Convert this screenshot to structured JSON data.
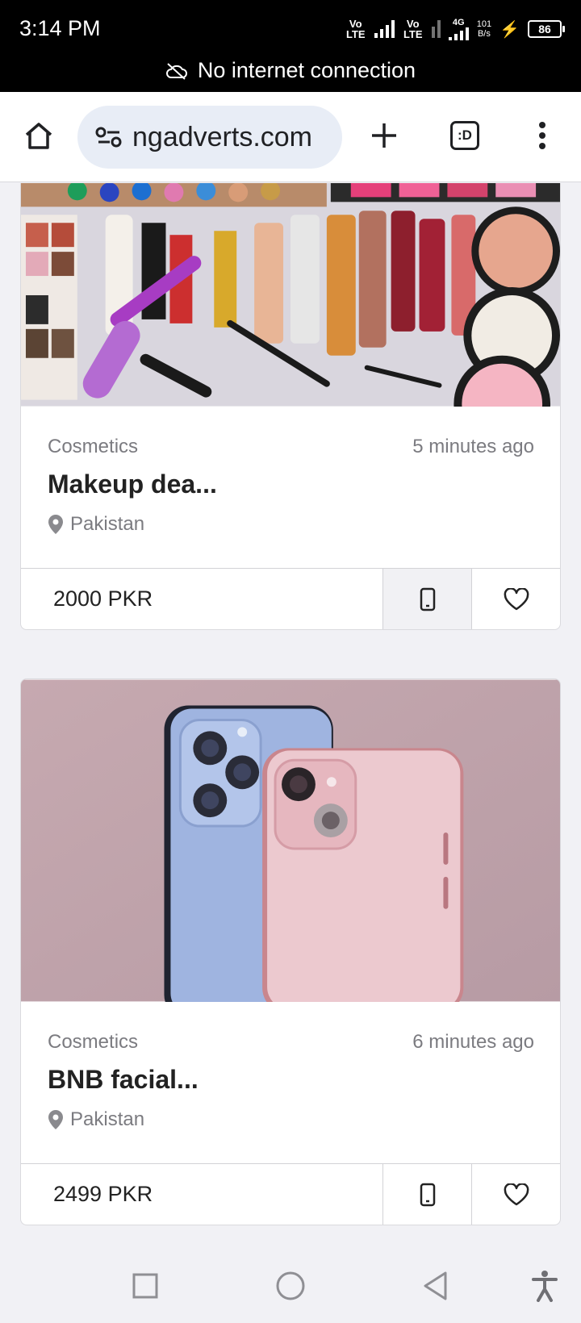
{
  "status_bar": {
    "time": "3:14 PM",
    "volte1": "Vo LTE",
    "volte2": "Vo LTE",
    "network": "4G",
    "speed_value": "101",
    "speed_unit": "B/s",
    "battery": "86",
    "banner": "No internet connection",
    "banner_icon": "cloud-off-icon"
  },
  "browser": {
    "url": "ngadverts.com",
    "tab_switcher_label": ":D",
    "icons": [
      "home-icon",
      "site-settings-icon",
      "new-tab-icon",
      "tab-switcher-icon",
      "more-menu-icon"
    ]
  },
  "listings": [
    {
      "category": "Cosmetics",
      "time_ago": "5 minutes ago",
      "title": "Makeup dea...",
      "location": "Pakistan",
      "price": "2000 PKR"
    },
    {
      "category": "Cosmetics",
      "time_ago": "6 minutes ago",
      "title": "BNB facial...",
      "location": "Pakistan",
      "price": "2499 PKR"
    }
  ],
  "nav_bar": {
    "icons": [
      "recents-icon",
      "home-circle-icon",
      "back-icon",
      "accessibility-icon"
    ]
  },
  "colors": {
    "status_bar_bg": "#000000",
    "url_pill": "#e8edf6",
    "page_bg": "#f1f1f5",
    "muted_text": "#7b7b80"
  }
}
